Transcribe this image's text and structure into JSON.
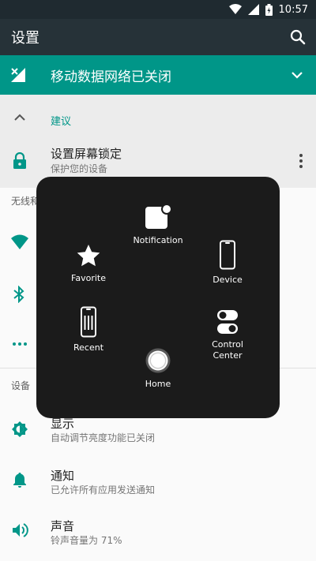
{
  "status_bar": {
    "time": "10:57"
  },
  "app_bar": {
    "title": "设置"
  },
  "banner": {
    "text": "移动数据网络已关闭"
  },
  "suggestions": {
    "title": "建议",
    "item": {
      "title": "设置屏幕锁定",
      "subtitle": "保护您的设备"
    }
  },
  "sections": {
    "wireless_partial": "无线和",
    "device": "设备"
  },
  "settings": [
    {
      "title": "显示",
      "subtitle": "自动调节亮度功能已关闭"
    },
    {
      "title": "通知",
      "subtitle": "已允许所有应用发送通知"
    },
    {
      "title": "声音",
      "subtitle": "铃声音量为 71%"
    }
  ],
  "assistive_menu": {
    "notification": "Notification",
    "favorite": "Favorite",
    "device": "Device",
    "recent": "Recent",
    "control_center": "Control Center",
    "home": "Home"
  },
  "colors": {
    "teal": "#009688",
    "toolbar": "#263238",
    "statusbar": "#1f2a30",
    "overlay": "#1b1b1b"
  }
}
